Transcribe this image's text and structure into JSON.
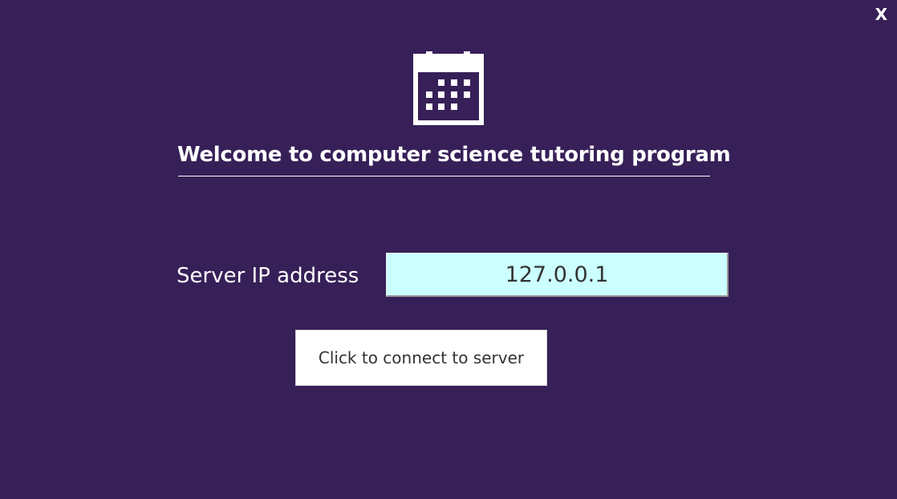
{
  "window": {
    "close_label": "X"
  },
  "header": {
    "logo_icon": "calendar-icon",
    "title": "Welcome to computer science tutoring program"
  },
  "form": {
    "server_ip_label": "Server IP address",
    "server_ip_value": "127.0.0.1",
    "connect_button_label": "Click to connect to server"
  },
  "colors": {
    "background": "#372058",
    "input_background": "#ccffff",
    "button_background": "#ffffff",
    "text": "#ffffff"
  }
}
